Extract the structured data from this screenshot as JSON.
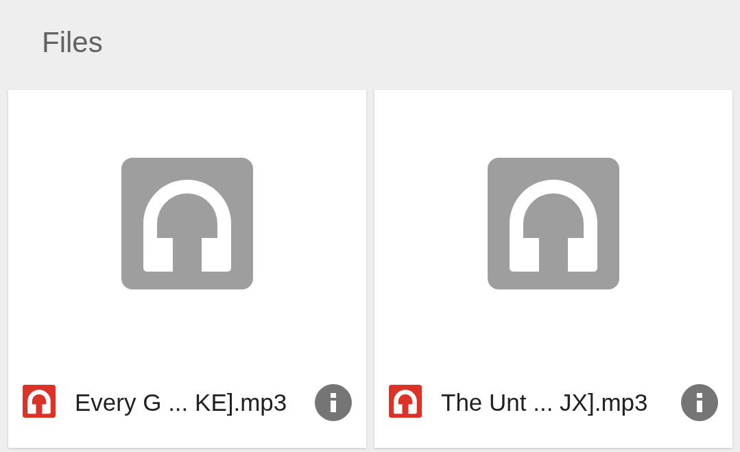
{
  "header": {
    "title": "Files"
  },
  "files": [
    {
      "name": "Every G ... KE].mp3"
    },
    {
      "name": "The Unt ... JX].mp3"
    }
  ]
}
